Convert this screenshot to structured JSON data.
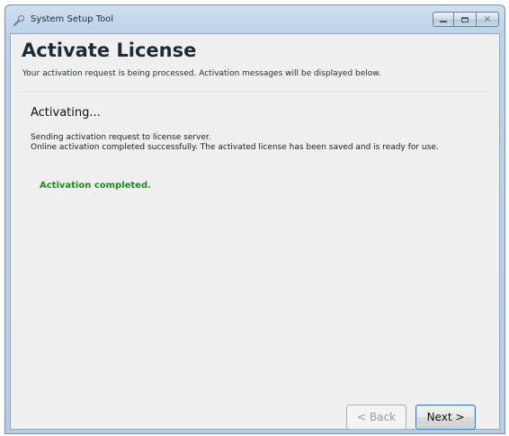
{
  "window": {
    "title": "System Setup Tool",
    "icon": "setup-wrench-icon",
    "controls": {
      "minimize_icon": "minimize-icon",
      "maximize_icon": "maximize-icon",
      "close_symbol": "⨯"
    }
  },
  "header": {
    "title": "Activate License",
    "subtitle": "Your activation request is being processed.  Activation messages will be displayed below."
  },
  "main": {
    "section_heading": "Activating...",
    "log_lines": [
      "Sending activation request to license server.",
      "Online activation completed successfully.  The activated license has been saved and is ready for use."
    ],
    "status": "Activation completed.",
    "status_color": "#1e8a1e"
  },
  "footer": {
    "back_label": "< Back",
    "back_enabled": false,
    "next_label": "Next >"
  }
}
